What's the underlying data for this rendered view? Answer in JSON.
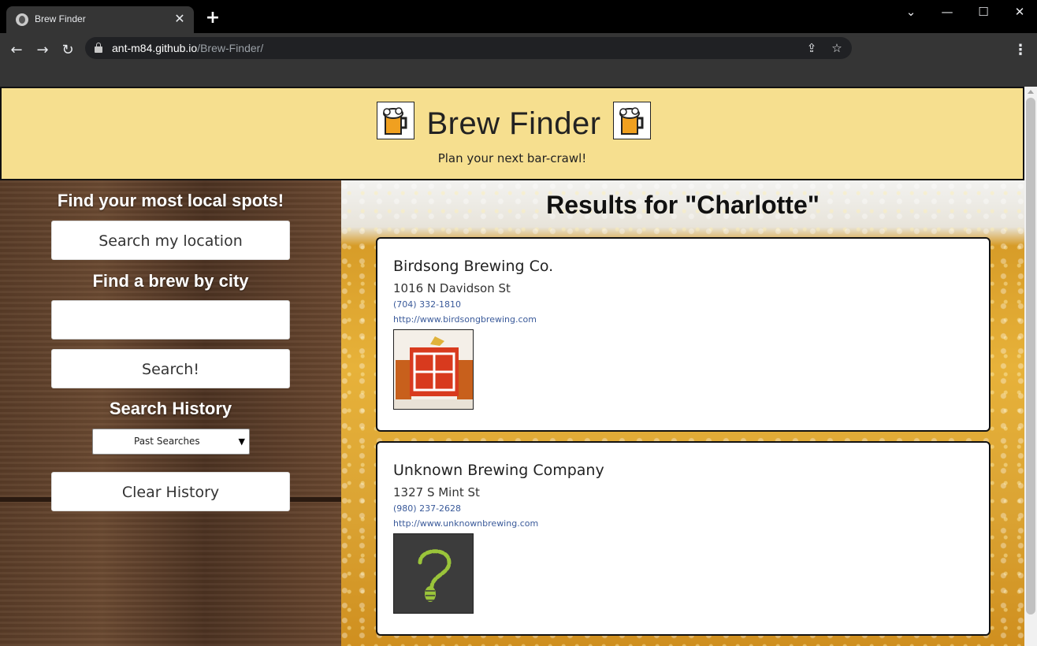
{
  "browser": {
    "tab_title": "Brew Finder",
    "url_host": "ant-m84.github.io",
    "url_path": "/Brew-Finder/"
  },
  "header": {
    "title": "Brew Finder",
    "subtitle": "Plan your next bar-crawl!"
  },
  "sidebar": {
    "local_heading": "Find your most local spots!",
    "location_button": "Search my location",
    "city_heading": "Find a brew by city",
    "city_input_value": "",
    "search_button": "Search!",
    "history_heading": "Search History",
    "history_select": "Past Searches",
    "clear_button": "Clear History"
  },
  "results": {
    "title": "Results for \"Charlotte\"",
    "breweries": [
      {
        "name": "Birdsong Brewing Co.",
        "address": "1016 N Davidson St",
        "phone": "(704) 332-1810",
        "website": "http://www.birdsongbrewing.com",
        "logo_icon": "birdsong-logo-icon"
      },
      {
        "name": "Unknown Brewing Company",
        "address": "1327 S Mint St",
        "phone": "(980) 237-2628",
        "website": "http://www.unknownbrewing.com",
        "logo_icon": "hop-question-mark-icon"
      }
    ]
  },
  "colors": {
    "header_bg": "#f6df8f",
    "link": "#3a5a9a"
  }
}
